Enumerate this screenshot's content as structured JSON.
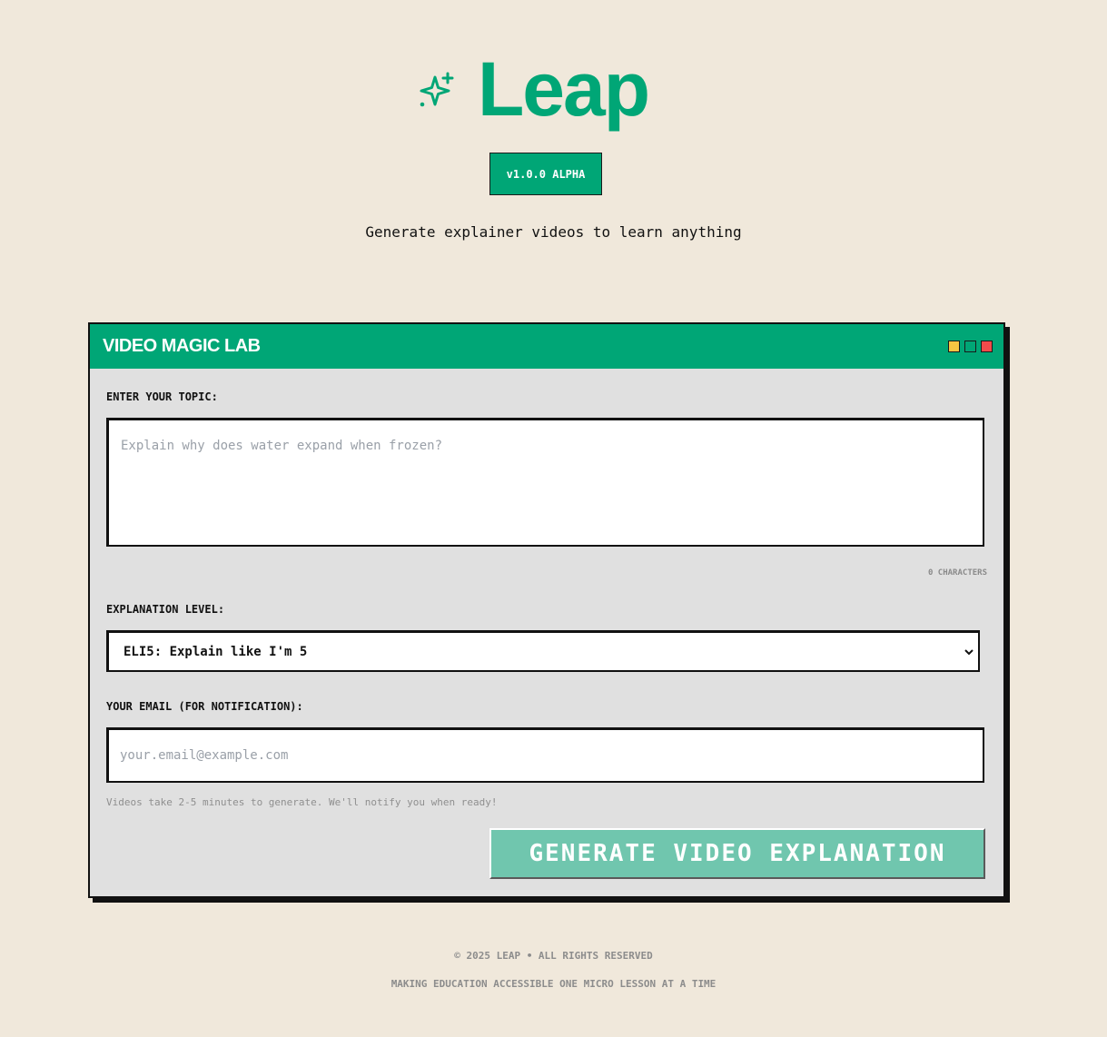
{
  "brand": {
    "name": "Leap",
    "icon": "sparkle-icon",
    "color": "#00a676"
  },
  "version_badge": "v1.0.0 ALPHA",
  "tagline": "Generate explainer videos to learn anything",
  "panel": {
    "title": "VIDEO MAGIC LAB",
    "window_controls": [
      {
        "name": "minimize",
        "color": "#f5c542"
      },
      {
        "name": "maximize",
        "color": "#00a676"
      },
      {
        "name": "close",
        "color": "#f24b4b"
      }
    ]
  },
  "form": {
    "topic": {
      "label": "ENTER YOUR TOPIC:",
      "value": "",
      "placeholder": "Explain why does water expand when frozen?",
      "char_count": "0 CHARACTERS"
    },
    "level": {
      "label": "EXPLANATION LEVEL:",
      "selected": "ELI5: Explain like I'm 5"
    },
    "email": {
      "label": "YOUR EMAIL (FOR NOTIFICATION):",
      "value": "",
      "placeholder": "your.email@example.com"
    },
    "hint": "Videos take 2-5 minutes to generate. We'll notify you when ready!",
    "submit_label": "GENERATE VIDEO EXPLANATION"
  },
  "footer": {
    "copyright": "© 2025 LEAP • ALL RIGHTS RESERVED",
    "mission": "MAKING EDUCATION ACCESSIBLE ONE MICRO LESSON AT A TIME"
  }
}
